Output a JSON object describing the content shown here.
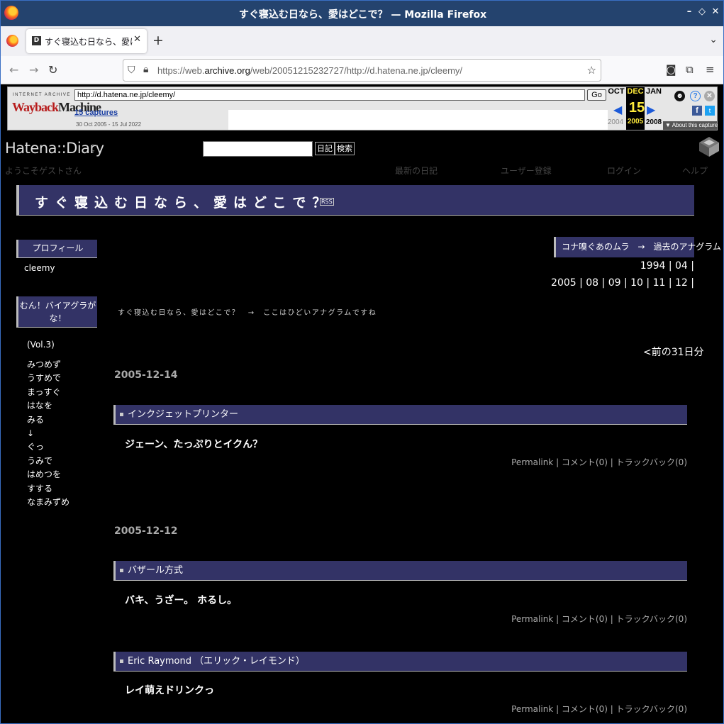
{
  "window": {
    "title": "すぐ寝込む日なら、愛はどこで？ — Mozilla Firefox",
    "minimize": "–",
    "restore": "◇",
    "close": "✕"
  },
  "tabs": [
    {
      "label": "すぐ寝込む日なら、愛はどこで？",
      "favicon": "D",
      "close": "✕"
    }
  ],
  "toolbar": {
    "new_tab": "+",
    "tab_list": "⌄",
    "back": "←",
    "forward": "→",
    "reload": "↻",
    "url_prefix": "https://web.",
    "url_domain": "archive.org",
    "url_rest": "/web/20051215232727/http://d.hatena.ne.jp/cleemy/",
    "bookmark": "☆",
    "pocket": "◙",
    "extensions": "⧉",
    "menu": "≡"
  },
  "wayback": {
    "ia_label": "INTERNET ARCHIVE",
    "logo_a": "Wayback",
    "logo_b": "Machine",
    "url_value": "http://d.hatena.ne.jp/cleemy/",
    "go_label": "Go",
    "captures": "15 captures",
    "range": "30 Oct 2005 - 15 Jul 2022",
    "months": [
      "OCT",
      "DEC",
      "JAN"
    ],
    "day": "15",
    "years": [
      "2004",
      "2005",
      "2008"
    ],
    "about": "▼ About this capture",
    "prev_arrow": "◀",
    "next_arrow": "▶",
    "user": "☻",
    "help": "?",
    "close": "✕",
    "fb": "f",
    "tw": "t"
  },
  "hatena": {
    "logo": "Hatena::Diary",
    "logo_arrows": "▵\n▿",
    "diary_btn": "日記",
    "search_btn": "検索",
    "welcome": "ようこそゲストさん",
    "nav": [
      "最新の日記",
      "ユーザー登録",
      "ログイン",
      "ヘルプ"
    ],
    "title": "すぐ寝込む日なら、愛はどこで？",
    "rss": "RSS"
  },
  "sidebar": {
    "profile_heading": "プロフィール",
    "profile_name": "cleemy",
    "section2_heading": "むん！バイアグラがな！",
    "vol": "(Vol.3)",
    "items": [
      "みつめず",
      "うすめで",
      "まっすぐ",
      "はなを",
      "みる",
      "↓",
      "ぐっ",
      "うみで",
      "はめつを",
      "すする",
      "なまみずめ"
    ]
  },
  "main": {
    "anagram_box": "コナ嗅ぐあのムラ　→　過去のアナグラム",
    "archive_line1": "1994 | 04 |",
    "archive_line2": "2005 | 08 | 09 | 10 | 11 | 12 |",
    "description": "すぐ寝込む日なら、愛はどこで？　→　ここはひどいアナグラムですね",
    "prev_link": "<前の31日分",
    "entries": [
      {
        "date": "2005-12-14",
        "heading": "インクジェットプリンター",
        "body": "ジェーン、たっぷりとイクん？",
        "footer": "Permalink | コメント(0) | トラックバック(0)"
      },
      {
        "date": "2005-12-12",
        "heading": "バザール方式",
        "body": "バキ、うざー。 ホるし。",
        "footer": "Permalink | コメント(0) | トラックバック(0)"
      },
      {
        "date": "",
        "heading": "Eric Raymond （エリック・レイモンド）",
        "body": "レイ萌えドリンクっ",
        "footer": "Permalink | コメント(0) | トラックバック(0)"
      }
    ]
  }
}
